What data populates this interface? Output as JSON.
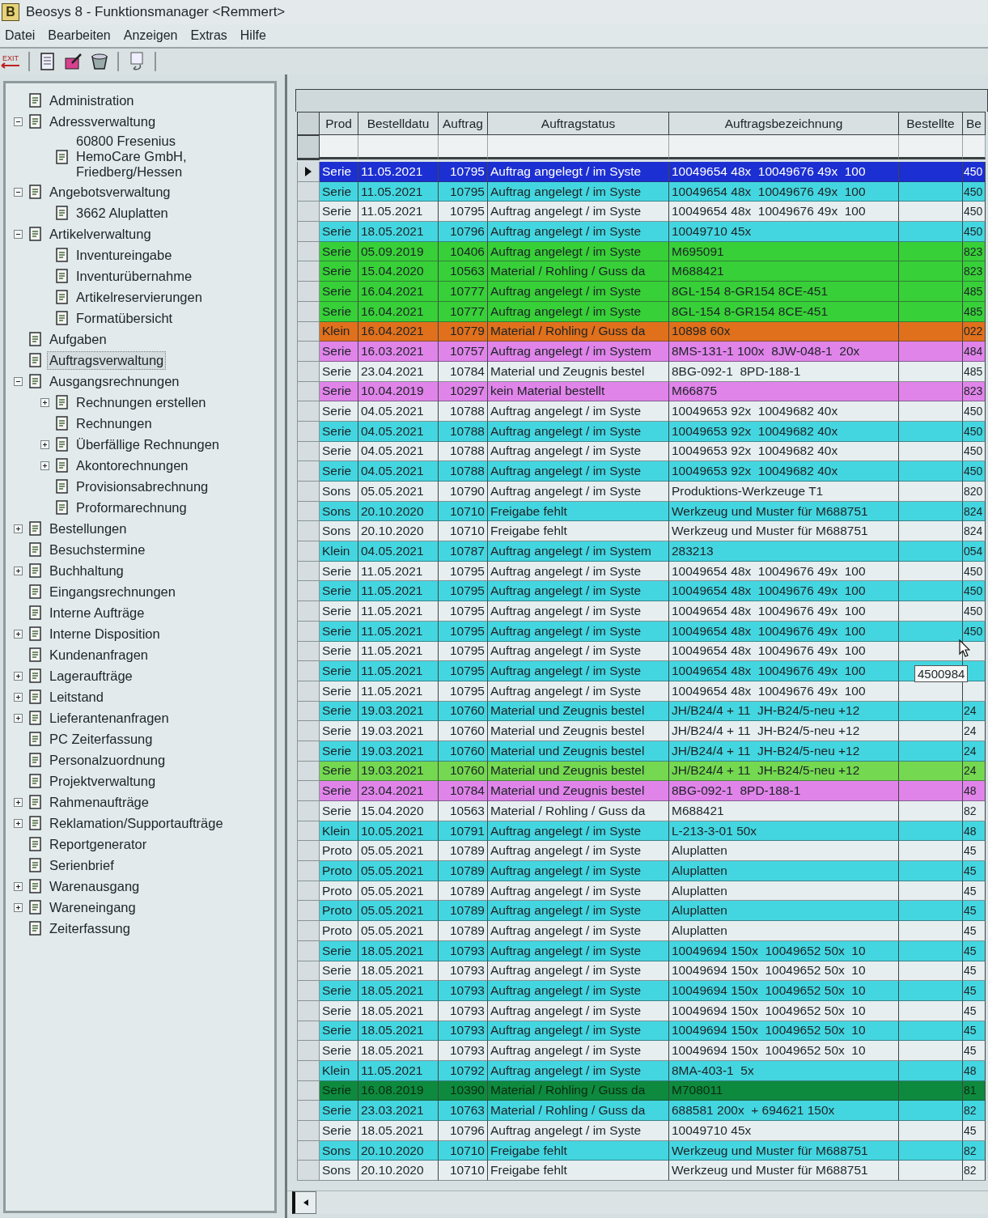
{
  "window": {
    "app_icon": "B",
    "title": "Beosys 8 - Funktionsmanager <Remmert>"
  },
  "menu": [
    "Datei",
    "Bearbeiten",
    "Anzeigen",
    "Extras",
    "Hilfe"
  ],
  "toolbar": {
    "exit_label": "EXIT"
  },
  "tree": [
    {
      "label": "Administration",
      "selected": false
    },
    {
      "label": "Adressverwaltung",
      "selected": false,
      "expanded": true,
      "children": [
        {
          "label": "60800 Fresenius HemoCare GmbH, Friedberg/Hessen",
          "selected": false
        }
      ]
    },
    {
      "label": "Angebotsverwaltung",
      "selected": false,
      "expanded": true,
      "children": [
        {
          "label": "3662 Aluplatten",
          "selected": false
        }
      ]
    },
    {
      "label": "Artikelverwaltung",
      "selected": false,
      "expanded": true,
      "children": [
        {
          "label": "Inventureingabe",
          "selected": false
        },
        {
          "label": "Inventurübernahme",
          "selected": false
        },
        {
          "label": "Artikelreservierungen",
          "selected": false
        },
        {
          "label": "Formatübersicht",
          "selected": false
        }
      ]
    },
    {
      "label": "Aufgaben",
      "selected": false
    },
    {
      "label": "Auftragsverwaltung",
      "selected": true
    },
    {
      "label": "Ausgangsrechnungen",
      "selected": false,
      "expanded": true,
      "children": [
        {
          "label": "Rechnungen erstellen",
          "selected": false,
          "expanded": false
        },
        {
          "label": "Rechnungen",
          "selected": false
        },
        {
          "label": "Überfällige Rechnungen",
          "selected": false,
          "expanded": false
        },
        {
          "label": "Akontorechnungen",
          "selected": false,
          "expanded": false
        },
        {
          "label": "Provisionsabrechnung",
          "selected": false
        },
        {
          "label": "Proformarechnung",
          "selected": false
        }
      ]
    },
    {
      "label": "Bestellungen",
      "selected": false,
      "expanded": false
    },
    {
      "label": "Besuchstermine",
      "selected": false
    },
    {
      "label": "Buchhaltung",
      "selected": false,
      "expanded": false
    },
    {
      "label": "Eingangsrechnungen",
      "selected": false
    },
    {
      "label": "Interne Aufträge",
      "selected": false
    },
    {
      "label": "Interne Disposition",
      "selected": false,
      "expanded": false
    },
    {
      "label": "Kundenanfragen",
      "selected": false
    },
    {
      "label": "Lageraufträge",
      "selected": false,
      "expanded": false
    },
    {
      "label": "Leitstand",
      "selected": false,
      "expanded": false
    },
    {
      "label": "Lieferantenanfragen",
      "selected": false,
      "expanded": false
    },
    {
      "label": "PC Zeiterfassung",
      "selected": false
    },
    {
      "label": "Personalzuordnung",
      "selected": false
    },
    {
      "label": "Projektverwaltung",
      "selected": false
    },
    {
      "label": "Rahmenaufträge",
      "selected": false,
      "expanded": false
    },
    {
      "label": "Reklamation/Supportaufträge",
      "selected": false,
      "expanded": false
    },
    {
      "label": "Reportgenerator",
      "selected": false
    },
    {
      "label": "Serienbrief",
      "selected": false
    },
    {
      "label": "Warenausgang",
      "selected": false,
      "expanded": false
    },
    {
      "label": "Wareneingang",
      "selected": false,
      "expanded": false
    },
    {
      "label": "Zeiterfassung",
      "selected": false
    }
  ],
  "table": {
    "columns": [
      "Prod",
      "Bestelldatu",
      "Auftrag",
      "Auftragstatus",
      "Auftragsbezeichnung",
      "Bestellte",
      "Be"
    ],
    "tooltip": "4500984",
    "rows": [
      {
        "prod": "Serie",
        "date": "11.05.2021",
        "order": "10795",
        "status": "Auftrag angelegt / im Syste",
        "description": "10049654 48x  10049676 49x  100",
        "column_8": "450",
        "color": "#1c2fd2",
        "selected": true
      },
      {
        "prod": "Serie",
        "date": "11.05.2021",
        "order": "10795",
        "status": "Auftrag angelegt / im Syste",
        "description": "10049654 48x  10049676 49x  100",
        "column_8": "450",
        "color": "#44d6e0",
        "selected": false
      },
      {
        "prod": "Serie",
        "date": "11.05.2021",
        "order": "10795",
        "status": "Auftrag angelegt / im Syste",
        "description": "10049654 48x  10049676 49x  100",
        "column_8": "450",
        "color": "#e6eef0",
        "selected": false
      },
      {
        "prod": "Serie",
        "date": "18.05.2021",
        "order": "10796",
        "status": "Auftrag angelegt / im Syste",
        "description": "10049710 45x",
        "column_8": "450",
        "color": "#44d6e0",
        "selected": false
      },
      {
        "prod": "Serie",
        "date": "05.09.2019",
        "order": "10406",
        "status": "Auftrag angelegt / im Syste",
        "description": "M695091",
        "column_8": "823",
        "color": "#38d038",
        "selected": false
      },
      {
        "prod": "Serie",
        "date": "15.04.2020",
        "order": "10563",
        "status": "Material / Rohling / Guss da",
        "description": "M688421",
        "column_8": "823",
        "color": "#38d038",
        "selected": false
      },
      {
        "prod": "Serie",
        "date": "16.04.2021",
        "order": "10777",
        "status": "Auftrag angelegt / im Syste",
        "description": "8GL-154 8-GR154 8CE-451",
        "column_8": "485",
        "color": "#38d038",
        "selected": false
      },
      {
        "prod": "Serie",
        "date": "16.04.2021",
        "order": "10777",
        "status": "Auftrag angelegt / im Syste",
        "description": "8GL-154 8-GR154 8CE-451",
        "column_8": "485",
        "color": "#38d038",
        "selected": false
      },
      {
        "prod": "Klein",
        "date": "16.04.2021",
        "order": "10779",
        "status": "Material / Rohling / Guss da",
        "description": "10898 60x",
        "column_8": "022",
        "color": "#e0701c",
        "selected": false
      },
      {
        "prod": "Serie",
        "date": "16.03.2021",
        "order": "10757",
        "status": "Auftrag angelegt / im System",
        "description": "8MS-131-1 100x  8JW-048-1  20x",
        "column_8": "484",
        "color": "#e084ea",
        "selected": false
      },
      {
        "prod": "Serie",
        "date": "23.04.2021",
        "order": "10784",
        "status": "Material und Zeugnis bestel",
        "description": "8BG-092-1  8PD-188-1",
        "column_8": "485",
        "color": "#e6eef0",
        "selected": false
      },
      {
        "prod": "Serie",
        "date": "10.04.2019",
        "order": "10297",
        "status": "kein Material bestellt",
        "description": "M66875",
        "column_8": "823",
        "color": "#e084ea",
        "selected": false
      },
      {
        "prod": "Serie",
        "date": "04.05.2021",
        "order": "10788",
        "status": "Auftrag angelegt / im Syste",
        "description": "10049653 92x  10049682 40x",
        "column_8": "450",
        "color": "#e6eef0",
        "selected": false
      },
      {
        "prod": "Serie",
        "date": "04.05.2021",
        "order": "10788",
        "status": "Auftrag angelegt / im Syste",
        "description": "10049653 92x  10049682 40x",
        "column_8": "450",
        "color": "#44d6e0",
        "selected": false
      },
      {
        "prod": "Serie",
        "date": "04.05.2021",
        "order": "10788",
        "status": "Auftrag angelegt / im Syste",
        "description": "10049653 92x  10049682 40x",
        "column_8": "450",
        "color": "#e6eef0",
        "selected": false
      },
      {
        "prod": "Serie",
        "date": "04.05.2021",
        "order": "10788",
        "status": "Auftrag angelegt / im Syste",
        "description": "10049653 92x  10049682 40x",
        "column_8": "450",
        "color": "#44d6e0",
        "selected": false
      },
      {
        "prod": "Sons",
        "date": "05.05.2021",
        "order": "10790",
        "status": "Auftrag angelegt / im Syste",
        "description": "Produktions-Werkzeuge T1",
        "column_8": "820",
        "color": "#e6eef0",
        "selected": false
      },
      {
        "prod": "Sons",
        "date": "20.10.2020",
        "order": "10710",
        "status": "Freigabe fehlt",
        "description": "Werkzeug und Muster für M688751",
        "column_8": "824",
        "color": "#44d6e0",
        "selected": false
      },
      {
        "prod": "Sons",
        "date": "20.10.2020",
        "order": "10710",
        "status": "Freigabe fehlt",
        "description": "Werkzeug und Muster für M688751",
        "column_8": "824",
        "color": "#e6eef0",
        "selected": false
      },
      {
        "prod": "Klein",
        "date": "04.05.2021",
        "order": "10787",
        "status": "Auftrag angelegt / im System",
        "description": "283213",
        "column_8": "054",
        "color": "#44d6e0",
        "selected": false
      },
      {
        "prod": "Serie",
        "date": "11.05.2021",
        "order": "10795",
        "status": "Auftrag angelegt / im Syste",
        "description": "10049654 48x  10049676 49x  100",
        "column_8": "450",
        "color": "#e6eef0",
        "selected": false
      },
      {
        "prod": "Serie",
        "date": "11.05.2021",
        "order": "10795",
        "status": "Auftrag angelegt / im Syste",
        "description": "10049654 48x  10049676 49x  100",
        "column_8": "450",
        "color": "#44d6e0",
        "selected": false
      },
      {
        "prod": "Serie",
        "date": "11.05.2021",
        "order": "10795",
        "status": "Auftrag angelegt / im Syste",
        "description": "10049654 48x  10049676 49x  100",
        "column_8": "450",
        "color": "#e6eef0",
        "selected": false
      },
      {
        "prod": "Serie",
        "date": "11.05.2021",
        "order": "10795",
        "status": "Auftrag angelegt / im Syste",
        "description": "10049654 48x  10049676 49x  100",
        "column_8": "450",
        "color": "#44d6e0",
        "selected": false
      },
      {
        "prod": "Serie",
        "date": "11.05.2021",
        "order": "10795",
        "status": "Auftrag angelegt / im Syste",
        "description": "10049654 48x  10049676 49x  100",
        "column_8": "",
        "color": "#e6eef0",
        "selected": false
      },
      {
        "prod": "Serie",
        "date": "11.05.2021",
        "order": "10795",
        "status": "Auftrag angelegt / im Syste",
        "description": "10049654 48x  10049676 49x  100",
        "column_8": "",
        "color": "#44d6e0",
        "selected": false
      },
      {
        "prod": "Serie",
        "date": "11.05.2021",
        "order": "10795",
        "status": "Auftrag angelegt / im Syste",
        "description": "10049654 48x  10049676 49x  100",
        "column_8": "",
        "color": "#e6eef0",
        "selected": false
      },
      {
        "prod": "Serie",
        "date": "19.03.2021",
        "order": "10760",
        "status": "Material und Zeugnis bestel",
        "description": "JH/B24/4 + 11  JH-B24/5-neu +12",
        "column_8": "24",
        "color": "#44d6e0",
        "selected": false
      },
      {
        "prod": "Serie",
        "date": "19.03.2021",
        "order": "10760",
        "status": "Material und Zeugnis bestel",
        "description": "JH/B24/4 + 11  JH-B24/5-neu +12",
        "column_8": "24",
        "color": "#e6eef0",
        "selected": false
      },
      {
        "prod": "Serie",
        "date": "19.03.2021",
        "order": "10760",
        "status": "Material und Zeugnis bestel",
        "description": "JH/B24/4 + 11  JH-B24/5-neu +12",
        "column_8": "24",
        "color": "#44d6e0",
        "selected": false
      },
      {
        "prod": "Serie",
        "date": "19.03.2021",
        "order": "10760",
        "status": "Material und Zeugnis bestel",
        "description": "JH/B24/4 + 11  JH-B24/5-neu +12",
        "column_8": "24",
        "color": "#74d850",
        "selected": false
      },
      {
        "prod": "Serie",
        "date": "23.04.2021",
        "order": "10784",
        "status": "Material und Zeugnis bestel",
        "description": "8BG-092-1  8PD-188-1",
        "column_8": "48",
        "color": "#e084ea",
        "selected": false
      },
      {
        "prod": "Serie",
        "date": "15.04.2020",
        "order": "10563",
        "status": "Material / Rohling / Guss da",
        "description": "M688421",
        "column_8": "82",
        "color": "#e6eef0",
        "selected": false
      },
      {
        "prod": "Klein",
        "date": "10.05.2021",
        "order": "10791",
        "status": "Auftrag angelegt / im Syste",
        "description": "L-213-3-01 50x",
        "column_8": "48",
        "color": "#44d6e0",
        "selected": false
      },
      {
        "prod": "Proto",
        "date": "05.05.2021",
        "order": "10789",
        "status": "Auftrag angelegt / im Syste",
        "description": "Aluplatten",
        "column_8": "45",
        "color": "#e6eef0",
        "selected": false
      },
      {
        "prod": "Proto",
        "date": "05.05.2021",
        "order": "10789",
        "status": "Auftrag angelegt / im Syste",
        "description": "Aluplatten",
        "column_8": "45",
        "color": "#44d6e0",
        "selected": false
      },
      {
        "prod": "Proto",
        "date": "05.05.2021",
        "order": "10789",
        "status": "Auftrag angelegt / im Syste",
        "description": "Aluplatten",
        "column_8": "45",
        "color": "#e6eef0",
        "selected": false
      },
      {
        "prod": "Proto",
        "date": "05.05.2021",
        "order": "10789",
        "status": "Auftrag angelegt / im Syste",
        "description": "Aluplatten",
        "column_8": "45",
        "color": "#44d6e0",
        "selected": false
      },
      {
        "prod": "Proto",
        "date": "05.05.2021",
        "order": "10789",
        "status": "Auftrag angelegt / im Syste",
        "description": "Aluplatten",
        "column_8": "45",
        "color": "#e6eef0",
        "selected": false
      },
      {
        "prod": "Serie",
        "date": "18.05.2021",
        "order": "10793",
        "status": "Auftrag angelegt / im Syste",
        "description": "10049694 150x  10049652 50x  10",
        "column_8": "45",
        "color": "#44d6e0",
        "selected": false
      },
      {
        "prod": "Serie",
        "date": "18.05.2021",
        "order": "10793",
        "status": "Auftrag angelegt / im Syste",
        "description": "10049694 150x  10049652 50x  10",
        "column_8": "45",
        "color": "#e6eef0",
        "selected": false
      },
      {
        "prod": "Serie",
        "date": "18.05.2021",
        "order": "10793",
        "status": "Auftrag angelegt / im Syste",
        "description": "10049694 150x  10049652 50x  10",
        "column_8": "45",
        "color": "#44d6e0",
        "selected": false
      },
      {
        "prod": "Serie",
        "date": "18.05.2021",
        "order": "10793",
        "status": "Auftrag angelegt / im Syste",
        "description": "10049694 150x  10049652 50x  10",
        "column_8": "45",
        "color": "#e6eef0",
        "selected": false
      },
      {
        "prod": "Serie",
        "date": "18.05.2021",
        "order": "10793",
        "status": "Auftrag angelegt / im Syste",
        "description": "10049694 150x  10049652 50x  10",
        "column_8": "45",
        "color": "#44d6e0",
        "selected": false
      },
      {
        "prod": "Serie",
        "date": "18.05.2021",
        "order": "10793",
        "status": "Auftrag angelegt / im Syste",
        "description": "10049694 150x  10049652 50x  10",
        "column_8": "45",
        "color": "#e6eef0",
        "selected": false
      },
      {
        "prod": "Klein",
        "date": "11.05.2021",
        "order": "10792",
        "status": "Auftrag angelegt / im Syste",
        "description": "8MA-403-1  5x",
        "column_8": "48",
        "color": "#44d6e0",
        "selected": false
      },
      {
        "prod": "Serie",
        "date": "16.08.2019",
        "order": "10390",
        "status": "Material / Rohling / Guss da",
        "description": "M708011",
        "column_8": "81",
        "color": "#0e8a3e",
        "selected": false
      },
      {
        "prod": "Serie",
        "date": "23.03.2021",
        "order": "10763",
        "status": "Material / Rohling / Guss da",
        "description": "688581 200x  + 694621 150x",
        "column_8": "82",
        "color": "#44d6e0",
        "selected": false
      },
      {
        "prod": "Serie",
        "date": "18.05.2021",
        "order": "10796",
        "status": "Auftrag angelegt / im Syste",
        "description": "10049710 45x",
        "column_8": "45",
        "color": "#e6eef0",
        "selected": false
      },
      {
        "prod": "Sons",
        "date": "20.10.2020",
        "order": "10710",
        "status": "Freigabe fehlt",
        "description": "Werkzeug und Muster für M688751",
        "column_8": "82",
        "color": "#44d6e0",
        "selected": false
      },
      {
        "prod": "Sons",
        "date": "20.10.2020",
        "order": "10710",
        "status": "Freigabe fehlt",
        "description": "Werkzeug und Muster für M688751",
        "column_8": "82",
        "color": "#e6eef0",
        "selected": false
      }
    ]
  }
}
